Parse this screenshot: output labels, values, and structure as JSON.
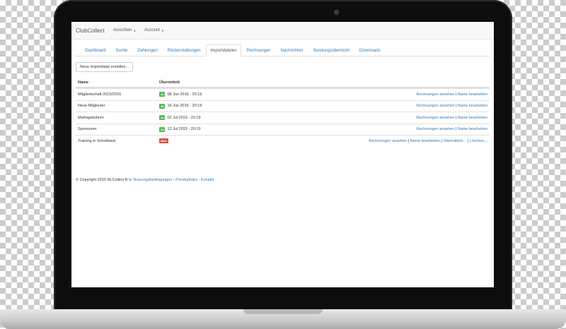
{
  "navbar": {
    "brand": "ClubCollect",
    "menus": [
      {
        "label": "Ansichten"
      },
      {
        "label": "Account"
      }
    ]
  },
  "tabs": [
    {
      "label": "Dashboard"
    },
    {
      "label": "Suche"
    },
    {
      "label": "Zahlungen"
    },
    {
      "label": "Rückerstattungen"
    },
    {
      "label": "Importdateien",
      "active": true
    },
    {
      "label": "Rechnungen"
    },
    {
      "label": "Nachrichten"
    },
    {
      "label": "Sendungsübersicht"
    },
    {
      "label": "Downloads"
    }
  ],
  "new_import_button": "Neue Importdatei erstellen...",
  "table": {
    "headers": {
      "name": "Name",
      "transmitted": "Übermittelt"
    },
    "rows": [
      {
        "name": "Mitgliedschaft 2015/2016",
        "badge": "Ja",
        "date": "08 Jun 2015 - 20:19",
        "actions": [
          "Rechnungen ansehen",
          "Name bearbeiten"
        ]
      },
      {
        "name": "Neue Mitglieder",
        "badge": "Ja",
        "date": "16 Jun 2015 - 20:19",
        "actions": [
          "Rechnungen ansehen",
          "Name bearbeiten"
        ]
      },
      {
        "name": "Mahngebühren",
        "badge": "Ja",
        "date": "02 Jul 2015 - 20:19",
        "actions": [
          "Rechnungen ansehen",
          "Name bearbeiten"
        ]
      },
      {
        "name": "Sponsoren",
        "badge": "Ja",
        "date": "12 Jul 2015 - 20:19",
        "actions": [
          "Rechnungen ansehen",
          "Name bearbeiten"
        ]
      },
      {
        "name": "Training in Schottland",
        "badge": "Nein",
        "date": "",
        "actions": [
          "Rechnungen ansehen",
          "Name bearbeiten",
          "Übermitteln...",
          "Löschen..."
        ]
      }
    ]
  },
  "footer": {
    "copyright": "© Copyright 2015 NLCollect B.V.",
    "links": [
      "Nutzungsbedingungen",
      "Privatsphäre",
      "Kontakt"
    ],
    "separator": " - "
  },
  "colors": {
    "link": "#337ab7",
    "badge_yes": "#5cb85c",
    "badge_no": "#d9534f"
  }
}
